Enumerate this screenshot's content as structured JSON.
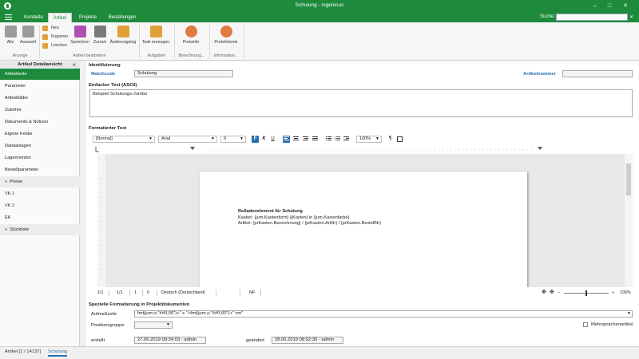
{
  "window": {
    "title": "Schulung - ingenious",
    "minimize": "–",
    "maximize": "□",
    "close": "✕"
  },
  "nav": {
    "tabs": [
      {
        "label": "Kontakte"
      },
      {
        "label": "Artikel"
      },
      {
        "label": "Projekte"
      },
      {
        "label": "Bestellungen"
      }
    ],
    "search_label": "Suche:",
    "search_value": "",
    "clear": "✕"
  },
  "ribbon": {
    "alle": "Alle",
    "auswahl": "Auswahl",
    "neu": "Neu",
    "kopieren": "Kopieren",
    "loeschen": "Löschen",
    "speichern": "Speichern",
    "zurueck": "Zurück",
    "aenderungslog": "Änderungslog",
    "task_erzeugen": "Task erzeugen",
    "preisinfo": "Preisinfo",
    "preishistorie": "Preishistorie",
    "groups": {
      "anzeige": "Anzeige",
      "artikel_bearbeiten": "Artikel bearbeiten",
      "aufgaben": "Aufgaben",
      "berechnung": "Berechnung...",
      "information": "Information..."
    }
  },
  "sidebar": {
    "title": "Artikel Detailansicht",
    "collapse": "«",
    "items": [
      {
        "label": "Artikeltexte"
      },
      {
        "label": "Parameter"
      },
      {
        "label": "Artikelbilder"
      },
      {
        "label": "Zubehör"
      },
      {
        "label": "Dokumente & Notizen"
      },
      {
        "label": "Eigene Felder"
      },
      {
        "label": "Dateianlagen"
      },
      {
        "label": "Lagermonitor"
      },
      {
        "label": "Bestellparameter"
      },
      {
        "label": "Preise"
      },
      {
        "label": "VK 1"
      },
      {
        "label": "VK 2"
      },
      {
        "label": "EK"
      },
      {
        "label": "Stückliste"
      }
    ]
  },
  "form": {
    "identifizierung": "Identifizierung",
    "matchcode_label": "Matchcode",
    "matchcode_value": "Schulung",
    "artikelnummer_label": "Artikelnummer",
    "artikelnummer_value": "",
    "einfacher_text_label": "Einfacher Text (ASCII)",
    "einfacher_text_value": "Beispiel Schulungs-Jumbo",
    "formatierter_text_label": "Formatierter Text",
    "editor": {
      "style": "[Normal]",
      "font": "Arial",
      "size": "9",
      "zoom_sel": "100%",
      "bold": "F",
      "italic": "K",
      "underline": "U",
      "pilcrow": "¶",
      "doc_lines": [
        "Rolladenelement für Schulung",
        "Kasten: {jum.Kastenform} {jKasten} in {jum.Kastenfarbe}",
        "Artikel: {prKasten.Bezeichnung} / {prKasten.ArtNr} / {prKasten.BestellNr}"
      ],
      "status": {
        "page": "1/1",
        "pages": "1/1",
        "line": "1",
        "col": "0",
        "language": "Deutsch (Deutschland)",
        "nf": "NF",
        "zoom": "100%",
        "zoom_level": 1.0
      }
    },
    "spezielle_label": "Spezielle Formatierung in Projektdokumenten",
    "aufmasszeile_label": "Aufmaßzeile",
    "aufmasszeile_value": "fmt(jum.x;\"##0,00\")+\" x \"+fmt(jum.y;\"##0,00\")+\" cm\"",
    "positionsgruppe_label": "Positionsgruppe",
    "mehrsprachen_label": "Mehrsprachenartikel",
    "erstellt_label": "erstellt",
    "erstellt_value": "27.06.2019 09:34:03 - admin",
    "geaendert_label": "geändert",
    "geaendert_value": "28.06.2019 08:52:30 - admin"
  },
  "bottom": {
    "tabs": [
      {
        "label": "Artikel [1 / 14137]"
      },
      {
        "label": "Schulung"
      }
    ]
  }
}
